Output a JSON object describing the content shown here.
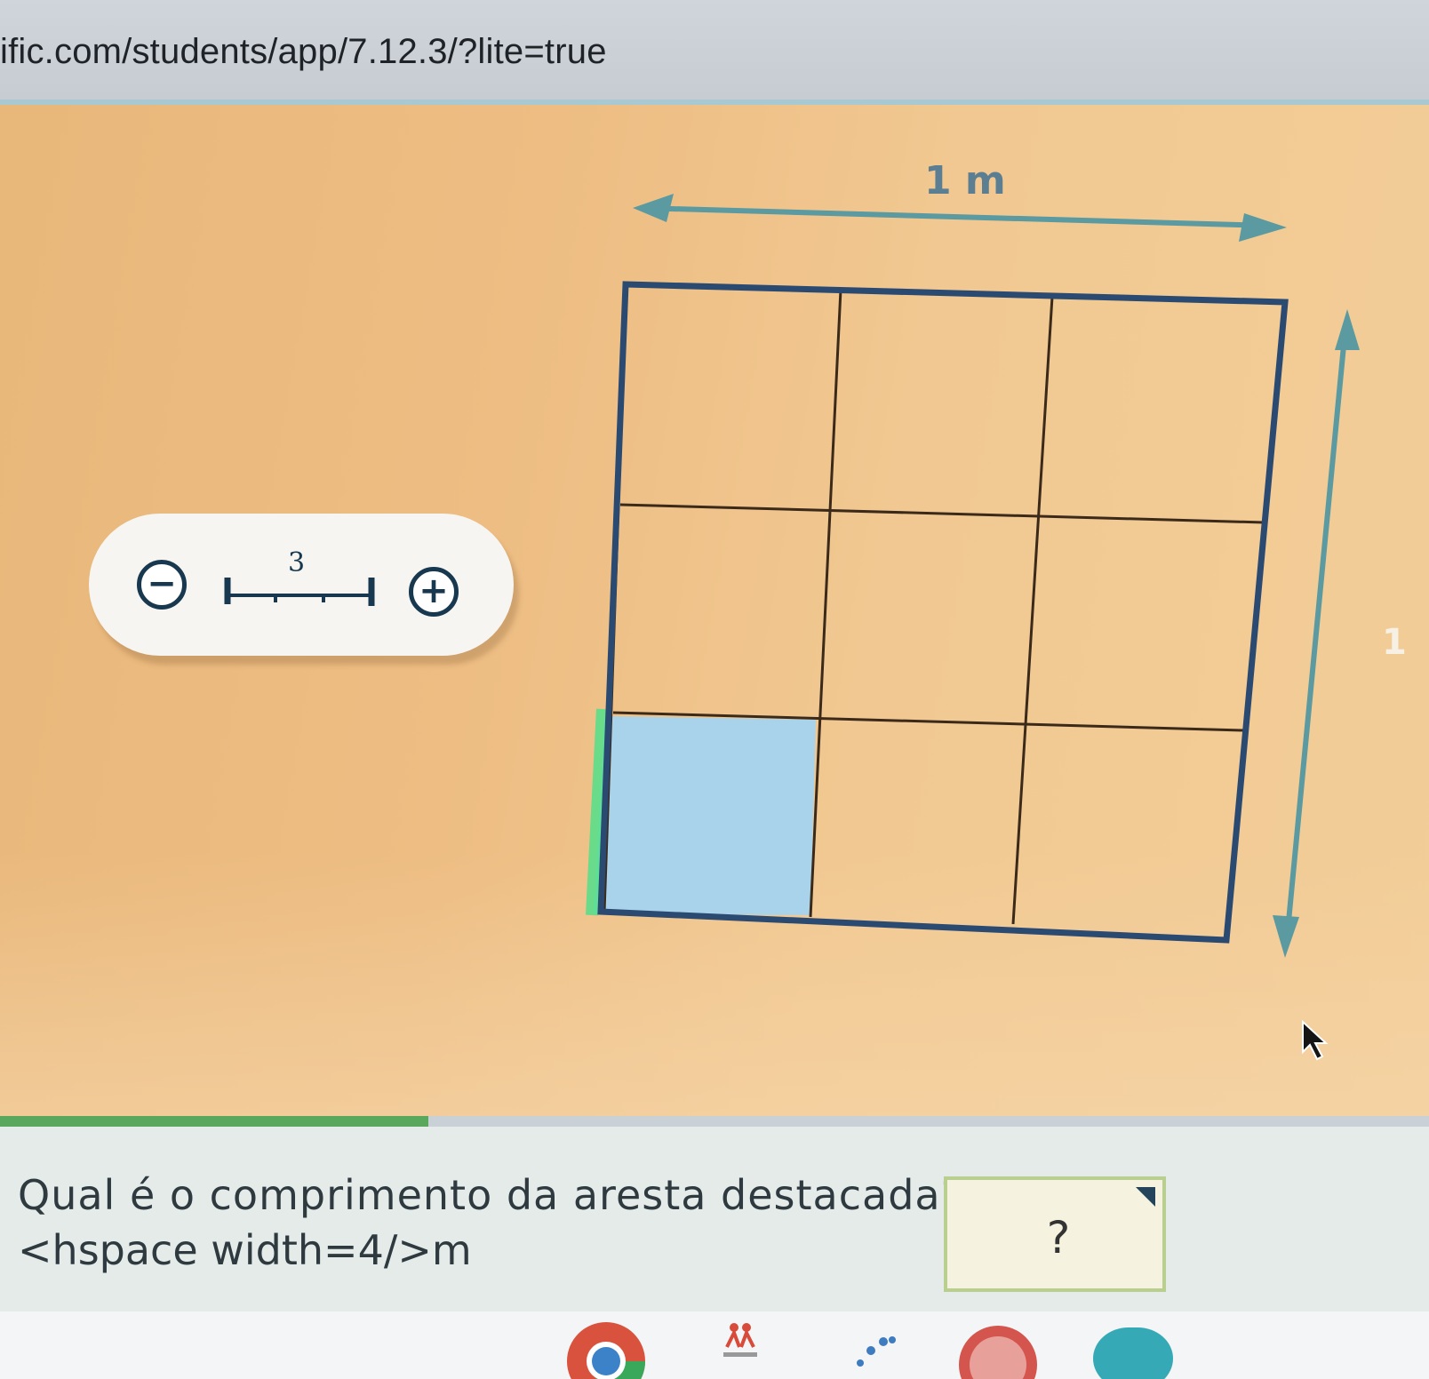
{
  "browser": {
    "url": "ific.com/students/app/7.12.3/?lite=true"
  },
  "scale_control": {
    "minus_icon": "minus-circle-icon",
    "plus_icon": "plus-circle-icon",
    "ruler_value": "3",
    "minus_symbol": "−",
    "plus_symbol": "+"
  },
  "figure": {
    "width_label": "1 m",
    "height_label": "1",
    "grid": {
      "rows": 3,
      "cols": 3
    },
    "highlighted_cell": {
      "row": 3,
      "col": 1
    },
    "colors": {
      "outline": "#2b4a72",
      "grid_line": "#3b2a1a",
      "highlight_fill": "#a9d3ea",
      "highlight_edge": "#53e08a",
      "arrow": "#5a9aa0"
    }
  },
  "question": {
    "text": "Qual é o comprimento da aresta destacada?",
    "sub": "<hspace width=4/>m",
    "answer_placeholder": "?"
  },
  "progress": {
    "fraction": 0.3
  },
  "taskbar": {
    "icons": [
      "chrome-icon",
      "sala-do-icon",
      "dots-icon",
      "red-app-icon",
      "teal-app-icon"
    ]
  }
}
